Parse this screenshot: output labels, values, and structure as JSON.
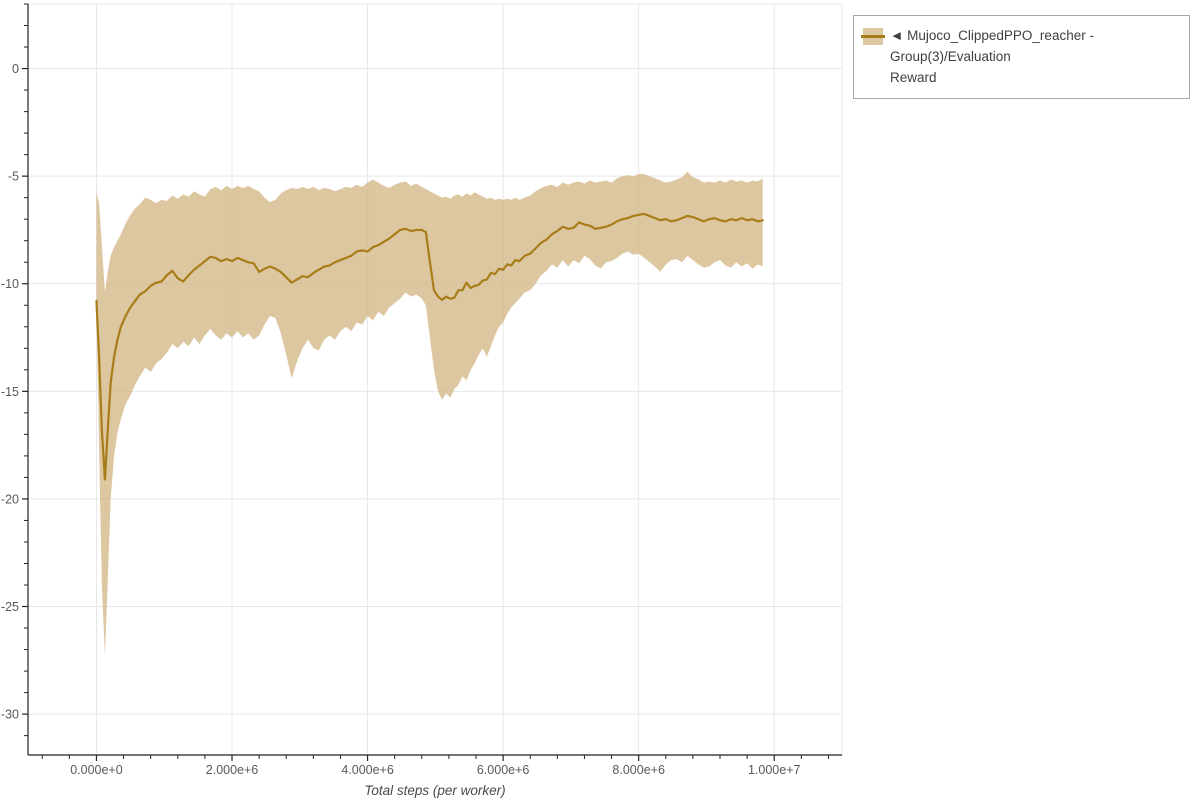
{
  "legend": {
    "marker": "◄",
    "line1": "◄ Mujoco_ClippedPPO_reacher - Group(3)/Evaluation",
    "line2": "Reward",
    "full_label": "Mujoco_ClippedPPO_reacher - Group(3)/Evaluation Reward"
  },
  "chart_data": {
    "type": "line",
    "title": "",
    "xlabel": "Total steps (per worker)",
    "ylabel": "",
    "grid": true,
    "legend_position": "outside-top-right",
    "x_range": [
      -1010000,
      11000000
    ],
    "y_range": [
      -31.9,
      3.0
    ],
    "x_unit": 1000000,
    "x_ticks": {
      "values": [
        0,
        2000000,
        4000000,
        6000000,
        8000000,
        10000000
      ],
      "labels": [
        "0.000e+0",
        "2.000e+6",
        "4.000e+6",
        "6.000e+6",
        "8.000e+6",
        "1.000e+7"
      ],
      "minor_step": 400000
    },
    "y_ticks": {
      "values": [
        0,
        -5,
        -10,
        -15,
        -20,
        -25,
        -30
      ],
      "labels": [
        "0",
        "-5",
        "-10",
        "-15",
        "-20",
        "-25",
        "-30"
      ],
      "minor_step": 1
    },
    "style": {
      "line_color": "#a87d19",
      "band_fill": "rgba(210,180,130,0.75)",
      "grid_color": "#e7e7e7",
      "axis_color": "#222222",
      "tick_label_color": "#595959",
      "axis_label_color": "#4a4a4a",
      "line_width": 2.2
    },
    "series": [
      {
        "name": "Mujoco_ClippedPPO_reacher - Group(3)/Evaluation Reward",
        "x_millions": [
          0,
          0.04,
          0.08,
          0.125,
          0.17,
          0.21,
          0.26,
          0.31,
          0.36,
          0.43,
          0.5,
          0.57,
          0.64,
          0.72,
          0.8,
          0.88,
          0.96,
          1.04,
          1.12,
          1.2,
          1.28,
          1.36,
          1.44,
          1.52,
          1.6,
          1.68,
          1.76,
          1.84,
          1.92,
          2.0,
          2.08,
          2.16,
          2.24,
          2.32,
          2.4,
          2.48,
          2.56,
          2.64,
          2.72,
          2.8,
          2.88,
          2.96,
          3.04,
          3.12,
          3.2,
          3.28,
          3.36,
          3.44,
          3.52,
          3.6,
          3.68,
          3.76,
          3.84,
          3.92,
          4.0,
          4.08,
          4.16,
          4.24,
          4.32,
          4.4,
          4.48,
          4.56,
          4.64,
          4.72,
          4.8,
          4.86,
          4.92,
          4.98,
          5.04,
          5.1,
          5.16,
          5.22,
          5.28,
          5.34,
          5.4,
          5.46,
          5.52,
          5.58,
          5.64,
          5.7,
          5.76,
          5.82,
          5.88,
          5.94,
          6.0,
          6.06,
          6.12,
          6.18,
          6.24,
          6.32,
          6.4,
          6.48,
          6.56,
          6.64,
          6.72,
          6.8,
          6.88,
          6.96,
          7.04,
          7.12,
          7.2,
          7.28,
          7.36,
          7.44,
          7.52,
          7.6,
          7.68,
          7.76,
          7.84,
          7.92,
          8.0,
          8.08,
          8.16,
          8.24,
          8.32,
          8.4,
          8.48,
          8.56,
          8.64,
          8.72,
          8.8,
          8.88,
          8.96,
          9.04,
          9.12,
          9.2,
          9.28,
          9.36,
          9.44,
          9.52,
          9.6,
          9.68,
          9.76,
          9.83
        ],
        "mean": [
          -10.8,
          -13.5,
          -16.8,
          -19.1,
          -16.6,
          -14.6,
          -13.4,
          -12.6,
          -12.0,
          -11.5,
          -11.1,
          -10.8,
          -10.5,
          -10.35,
          -10.1,
          -9.95,
          -9.9,
          -9.6,
          -9.4,
          -9.75,
          -9.9,
          -9.6,
          -9.35,
          -9.15,
          -8.95,
          -8.75,
          -8.8,
          -8.95,
          -8.85,
          -8.95,
          -8.8,
          -8.9,
          -9.0,
          -9.05,
          -9.45,
          -9.3,
          -9.2,
          -9.3,
          -9.45,
          -9.7,
          -9.95,
          -9.8,
          -9.65,
          -9.7,
          -9.5,
          -9.35,
          -9.2,
          -9.15,
          -9.0,
          -8.9,
          -8.8,
          -8.7,
          -8.5,
          -8.45,
          -8.5,
          -8.3,
          -8.2,
          -8.05,
          -7.9,
          -7.7,
          -7.5,
          -7.45,
          -7.55,
          -7.5,
          -7.5,
          -7.6,
          -9.0,
          -10.3,
          -10.6,
          -10.75,
          -10.6,
          -10.7,
          -10.65,
          -10.3,
          -10.3,
          -9.95,
          -10.2,
          -10.1,
          -10.05,
          -9.85,
          -9.8,
          -9.5,
          -9.55,
          -9.3,
          -9.35,
          -9.1,
          -9.15,
          -8.9,
          -8.95,
          -8.7,
          -8.6,
          -8.35,
          -8.1,
          -7.95,
          -7.7,
          -7.55,
          -7.35,
          -7.45,
          -7.4,
          -7.15,
          -7.25,
          -7.3,
          -7.45,
          -7.4,
          -7.35,
          -7.25,
          -7.1,
          -7.0,
          -6.95,
          -6.85,
          -6.8,
          -6.75,
          -6.85,
          -6.95,
          -7.05,
          -7.0,
          -7.1,
          -7.05,
          -6.95,
          -6.85,
          -6.9,
          -7.0,
          -7.1,
          -7.0,
          -6.95,
          -7.05,
          -7.1,
          -7.0,
          -7.05,
          -6.95,
          -7.05,
          -7.0,
          -7.1,
          -7.05
        ],
        "band_low": [
          -11.3,
          -18.0,
          -24.0,
          -27.3,
          -23.5,
          -20.0,
          -18.0,
          -16.9,
          -16.3,
          -15.6,
          -15.2,
          -14.7,
          -14.3,
          -13.9,
          -14.1,
          -13.7,
          -13.5,
          -13.2,
          -12.8,
          -13.0,
          -12.7,
          -12.9,
          -12.5,
          -12.8,
          -12.4,
          -12.1,
          -12.4,
          -12.6,
          -12.3,
          -12.5,
          -12.2,
          -12.5,
          -12.3,
          -12.6,
          -12.4,
          -11.9,
          -11.5,
          -11.6,
          -12.3,
          -13.3,
          -14.4,
          -13.6,
          -13.0,
          -12.6,
          -13.0,
          -13.1,
          -12.6,
          -12.4,
          -12.6,
          -12.2,
          -12.0,
          -12.2,
          -11.8,
          -11.9,
          -11.5,
          -11.7,
          -11.3,
          -11.5,
          -11.1,
          -10.9,
          -10.7,
          -10.4,
          -10.6,
          -10.5,
          -10.7,
          -11.0,
          -12.5,
          -14.0,
          -15.0,
          -15.4,
          -15.1,
          -15.3,
          -14.9,
          -14.7,
          -14.3,
          -14.5,
          -14.0,
          -13.7,
          -13.3,
          -13.0,
          -13.4,
          -12.9,
          -12.4,
          -12.0,
          -11.8,
          -11.4,
          -11.1,
          -10.9,
          -10.7,
          -10.4,
          -10.3,
          -10.0,
          -9.6,
          -9.4,
          -9.1,
          -9.25,
          -8.9,
          -9.2,
          -8.9,
          -9.05,
          -8.7,
          -8.85,
          -9.15,
          -9.3,
          -9.0,
          -8.95,
          -8.8,
          -8.6,
          -8.5,
          -8.65,
          -8.6,
          -8.8,
          -9.0,
          -9.2,
          -9.45,
          -9.1,
          -8.9,
          -8.85,
          -9.0,
          -8.7,
          -8.9,
          -9.1,
          -9.25,
          -9.2,
          -9.0,
          -8.9,
          -9.15,
          -9.25,
          -9.0,
          -9.2,
          -9.05,
          -9.3,
          -9.1,
          -9.2
        ],
        "band_high": [
          -5.7,
          -6.3,
          -8.2,
          -10.4,
          -9.4,
          -8.7,
          -8.3,
          -8.0,
          -7.7,
          -7.2,
          -6.8,
          -6.5,
          -6.3,
          -6.0,
          -6.1,
          -6.25,
          -6.1,
          -6.15,
          -5.9,
          -6.05,
          -5.85,
          -5.95,
          -5.7,
          -5.85,
          -5.95,
          -5.6,
          -5.5,
          -5.65,
          -5.45,
          -5.6,
          -5.45,
          -5.55,
          -5.45,
          -5.6,
          -5.7,
          -6.0,
          -6.2,
          -6.1,
          -5.8,
          -5.65,
          -5.55,
          -5.6,
          -5.5,
          -5.6,
          -5.5,
          -5.65,
          -5.55,
          -5.6,
          -5.7,
          -5.6,
          -5.5,
          -5.55,
          -5.4,
          -5.5,
          -5.3,
          -5.15,
          -5.3,
          -5.45,
          -5.55,
          -5.4,
          -5.3,
          -5.25,
          -5.45,
          -5.35,
          -5.5,
          -5.6,
          -5.7,
          -5.8,
          -5.9,
          -6.0,
          -5.95,
          -6.05,
          -5.9,
          -5.85,
          -5.95,
          -5.8,
          -5.9,
          -5.75,
          -5.85,
          -5.95,
          -6.05,
          -6.0,
          -6.1,
          -6.05,
          -6.1,
          -6.05,
          -6.1,
          -6.0,
          -6.1,
          -6.0,
          -5.9,
          -5.7,
          -5.55,
          -5.45,
          -5.4,
          -5.5,
          -5.3,
          -5.4,
          -5.3,
          -5.25,
          -5.35,
          -5.2,
          -5.3,
          -5.25,
          -5.2,
          -5.3,
          -5.1,
          -5.0,
          -4.95,
          -5.0,
          -4.9,
          -4.9,
          -5.0,
          -5.1,
          -5.2,
          -5.3,
          -5.25,
          -5.15,
          -5.05,
          -4.8,
          -5.05,
          -5.15,
          -5.3,
          -5.25,
          -5.3,
          -5.2,
          -5.3,
          -5.15,
          -5.25,
          -5.2,
          -5.3,
          -5.2,
          -5.25,
          -5.1
        ]
      }
    ]
  }
}
